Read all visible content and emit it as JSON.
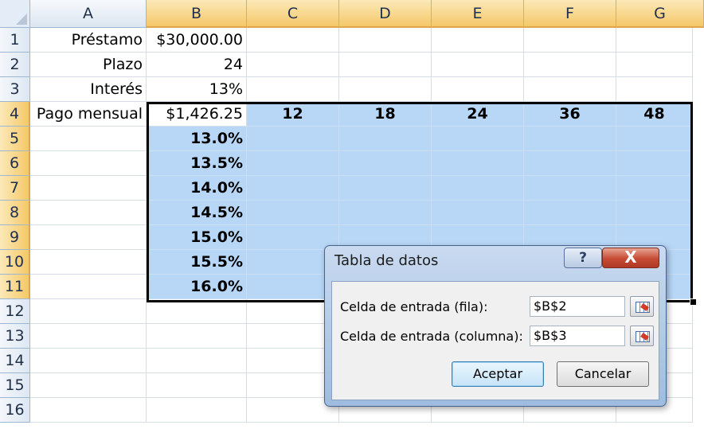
{
  "columns": [
    "A",
    "B",
    "C",
    "D",
    "E",
    "F",
    "G"
  ],
  "rows": [
    "1",
    "2",
    "3",
    "4",
    "5",
    "6",
    "7",
    "8",
    "9",
    "10",
    "11",
    "12",
    "13",
    "14",
    "15",
    "16"
  ],
  "cells": {
    "A1": "Préstamo",
    "B1": "$30,000.00",
    "A2": "Plazo",
    "B2": "24",
    "A3": "Interés",
    "B3": "13%",
    "A4": "Pago mensual",
    "B4": "$1,426.25",
    "C4": "12",
    "D4": "18",
    "E4": "24",
    "F4": "36",
    "G4": "48",
    "B5": "13.0%",
    "B6": "13.5%",
    "B7": "14.0%",
    "B8": "14.5%",
    "B9": "15.0%",
    "B10": "15.5%",
    "B11": "16.0%"
  },
  "dialog": {
    "title": "Tabla de datos",
    "help": "?",
    "close": "X",
    "row_label": "Celda de entrada (fila):",
    "row_value": "$B$2",
    "col_label": "Celda de entrada (columna):",
    "col_value": "$B$3",
    "ok": "Aceptar",
    "cancel": "Cancelar"
  },
  "colors": {
    "selection_fill": "#b8d7f7",
    "header_selected": "#f5c869"
  }
}
